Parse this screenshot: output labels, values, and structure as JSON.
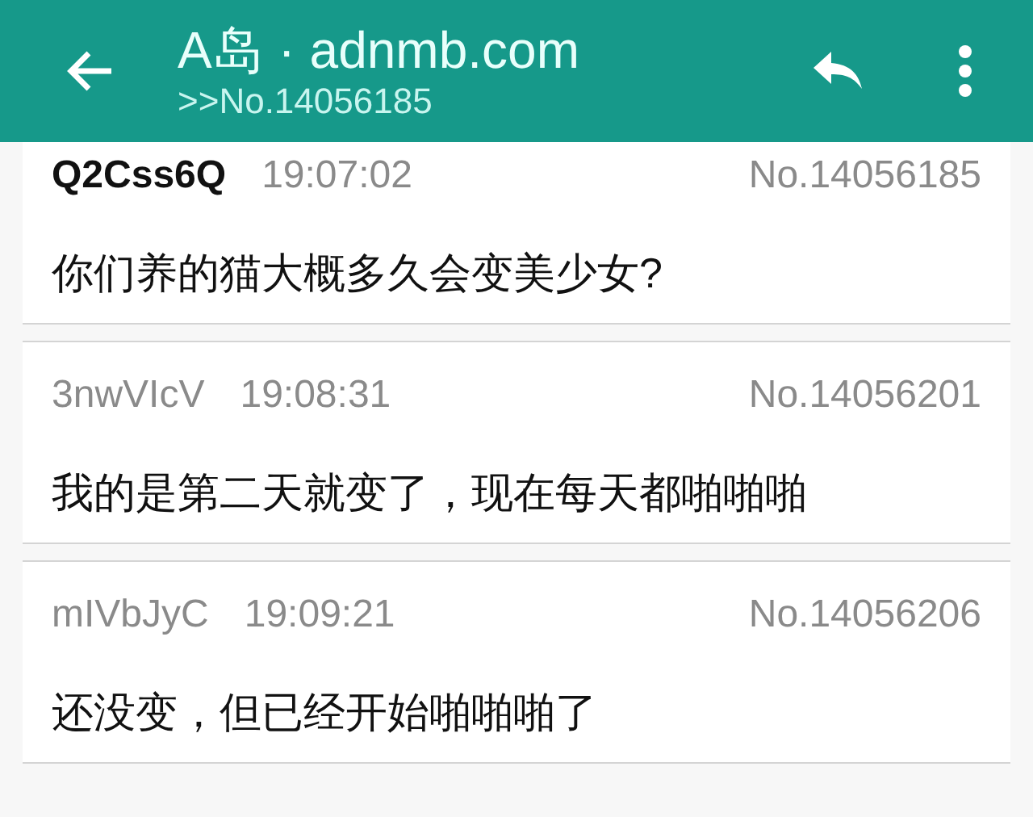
{
  "app_bar": {
    "title": "A岛 · adnmb.com",
    "subtitle": ">>No.14056185"
  },
  "posts": [
    {
      "kind": "op",
      "user_id": "Q2Css6Q",
      "time": "19:07:02",
      "number": "No.14056185",
      "content": "你们养的猫大概多久会变美少女?"
    },
    {
      "kind": "reply",
      "user_id": "3nwVIcV",
      "time": "19:08:31",
      "number": "No.14056201",
      "content": "我的是第二天就变了，现在每天都啪啪啪"
    },
    {
      "kind": "reply",
      "user_id": "mIVbJyC",
      "time": "19:09:21",
      "number": "No.14056206",
      "content": "还没变，但已经开始啪啪啪了"
    }
  ]
}
